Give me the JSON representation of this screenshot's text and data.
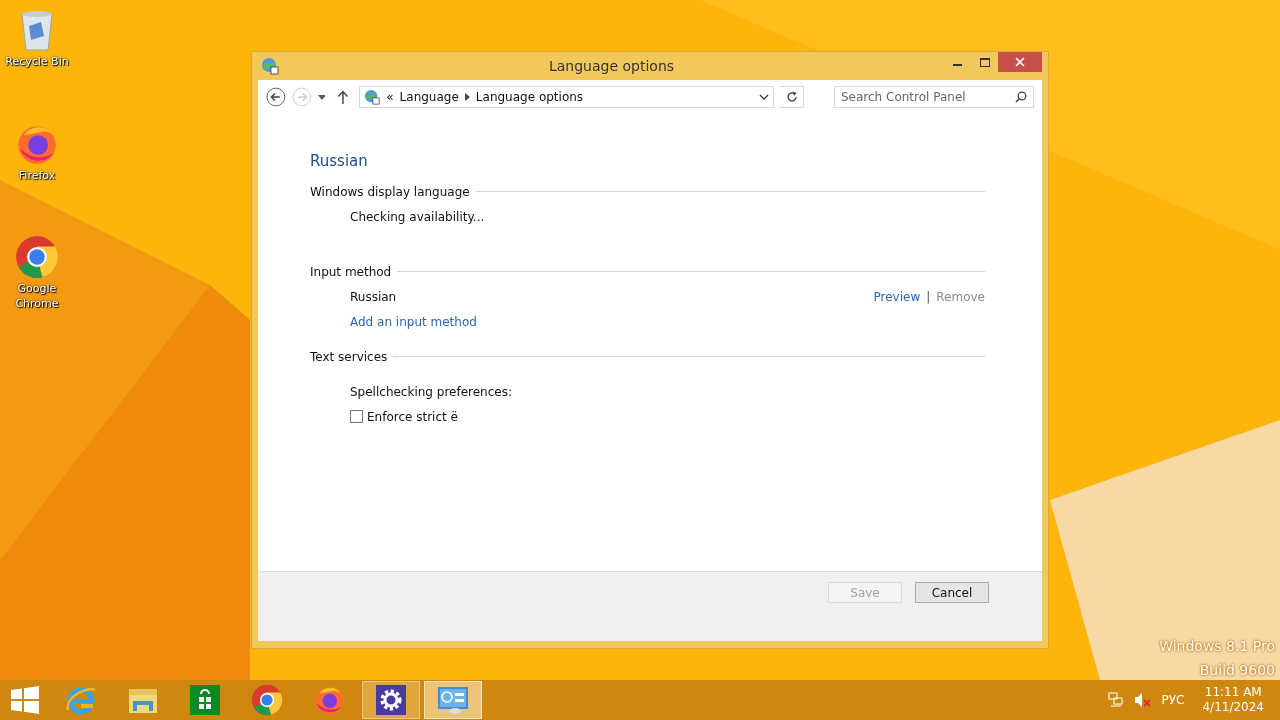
{
  "desktop_icons": [
    {
      "label": "Recycle Bin",
      "kind": "recycle"
    },
    {
      "label": "Firefox",
      "kind": "firefox"
    },
    {
      "label": "Google Chrome",
      "kind": "chrome"
    }
  ],
  "window": {
    "title": "Language options"
  },
  "address_bar": {
    "overflow_mark": "«",
    "breadcrumbs": [
      "Language",
      "Language options"
    ]
  },
  "search": {
    "placeholder": "Search Control Panel"
  },
  "heading": "Russian",
  "sections": [
    {
      "title": "Windows display language",
      "items": [
        {
          "kind": "status",
          "text": "Checking availability..."
        }
      ]
    },
    {
      "title": "Input method",
      "items": [
        {
          "kind": "method",
          "text": "Russian",
          "actions": [
            {
              "label": "Preview",
              "disabled": false
            },
            {
              "label": "Remove",
              "disabled": true
            }
          ],
          "separator": "|"
        },
        {
          "kind": "link",
          "text": "Add an input method"
        }
      ]
    },
    {
      "title": "Text services",
      "items": [
        {
          "kind": "label",
          "text": "Spellchecking preferences:"
        },
        {
          "kind": "checkbox",
          "text": "Enforce strict ё",
          "checked": false
        }
      ]
    }
  ],
  "buttons": [
    {
      "label": "Save",
      "disabled": true
    },
    {
      "label": "Cancel",
      "disabled": false
    }
  ],
  "os_watermark": [
    "Windows 8.1 Pro",
    "Build 9600"
  ],
  "taskbar": {
    "apps": [
      {
        "kind": "ie",
        "running": false,
        "selected": false
      },
      {
        "kind": "explorer",
        "running": false,
        "selected": false
      },
      {
        "kind": "store",
        "running": false,
        "selected": false
      },
      {
        "kind": "chrome",
        "running": false,
        "selected": false
      },
      {
        "kind": "firefox",
        "running": false,
        "selected": false
      },
      {
        "kind": "settings",
        "running": true,
        "selected": false
      },
      {
        "kind": "control",
        "running": true,
        "selected": true
      }
    ],
    "tray": {
      "language": "РУС",
      "time": "11:11 AM",
      "date": "4/11/2024"
    }
  }
}
